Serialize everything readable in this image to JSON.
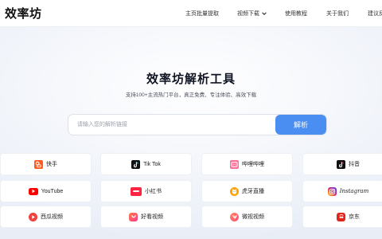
{
  "header": {
    "logo": "效率坊",
    "nav": [
      {
        "label": "主页批量提取"
      },
      {
        "label": "视频下载",
        "has_dropdown": true
      },
      {
        "label": "使用教程"
      },
      {
        "label": "关于我们"
      },
      {
        "label": "建议反"
      }
    ]
  },
  "hero": {
    "title": "效率坊解析工具",
    "subtitle": "支持100+主流热门平台，真正免费、专注体验、高效下载"
  },
  "search": {
    "placeholder": "请输入您的解析链接",
    "value": "",
    "button_label": "解析"
  },
  "platforms": [
    {
      "label": "快手",
      "icon": "kuaishou-icon",
      "color": "#ff5a1f"
    },
    {
      "label": "Tik Tok",
      "icon": "tiktok-icon",
      "color": "#111111"
    },
    {
      "label": "哔哩哔哩",
      "icon": "bilibili-icon",
      "color": "#fb7299"
    },
    {
      "label": "抖音",
      "icon": "douyin-icon",
      "color": "#111111"
    },
    {
      "label": "YouTube",
      "icon": "youtube-icon",
      "color": "#ff0000"
    },
    {
      "label": "小红书",
      "icon": "xiaohongshu-icon",
      "color": "#ff2442"
    },
    {
      "label": "虎牙直播",
      "icon": "huya-icon",
      "color": "#ffa200"
    },
    {
      "label": "Instagram",
      "icon": "instagram-icon",
      "color": "#d62976"
    },
    {
      "label": "西瓜视频",
      "icon": "xigua-icon",
      "color": "#f0413a"
    },
    {
      "label": "好看视频",
      "icon": "haokan-icon",
      "color": "#ff4f6b"
    },
    {
      "label": "微视视频",
      "icon": "weishi-icon",
      "color": "#ff5d73"
    },
    {
      "label": "京东",
      "icon": "jd-icon",
      "color": "#e1251b"
    }
  ]
}
